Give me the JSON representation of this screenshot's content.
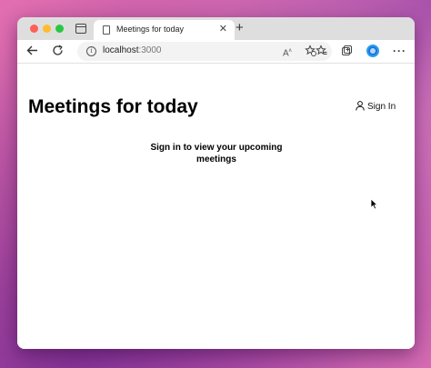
{
  "browser": {
    "tab": {
      "title": "Meetings for today",
      "close_glyph": "✕"
    },
    "new_tab_glyph": "+",
    "address_bar": {
      "host": "localhost",
      "port": ":3000"
    },
    "icons": [
      "back-icon",
      "reload-icon",
      "info-icon",
      "read-aloud-icon",
      "add-favorite-icon",
      "favorites-icon",
      "collections-icon",
      "profile-icon",
      "more-icon"
    ]
  },
  "page": {
    "title": "Meetings for today",
    "sign_in_label": "Sign In",
    "message": "Sign in to view your upcoming meetings"
  },
  "colors": {
    "accent": "#1a73e8",
    "close": "#fe5f57",
    "minimize": "#febc2e",
    "maximize": "#28c840"
  }
}
